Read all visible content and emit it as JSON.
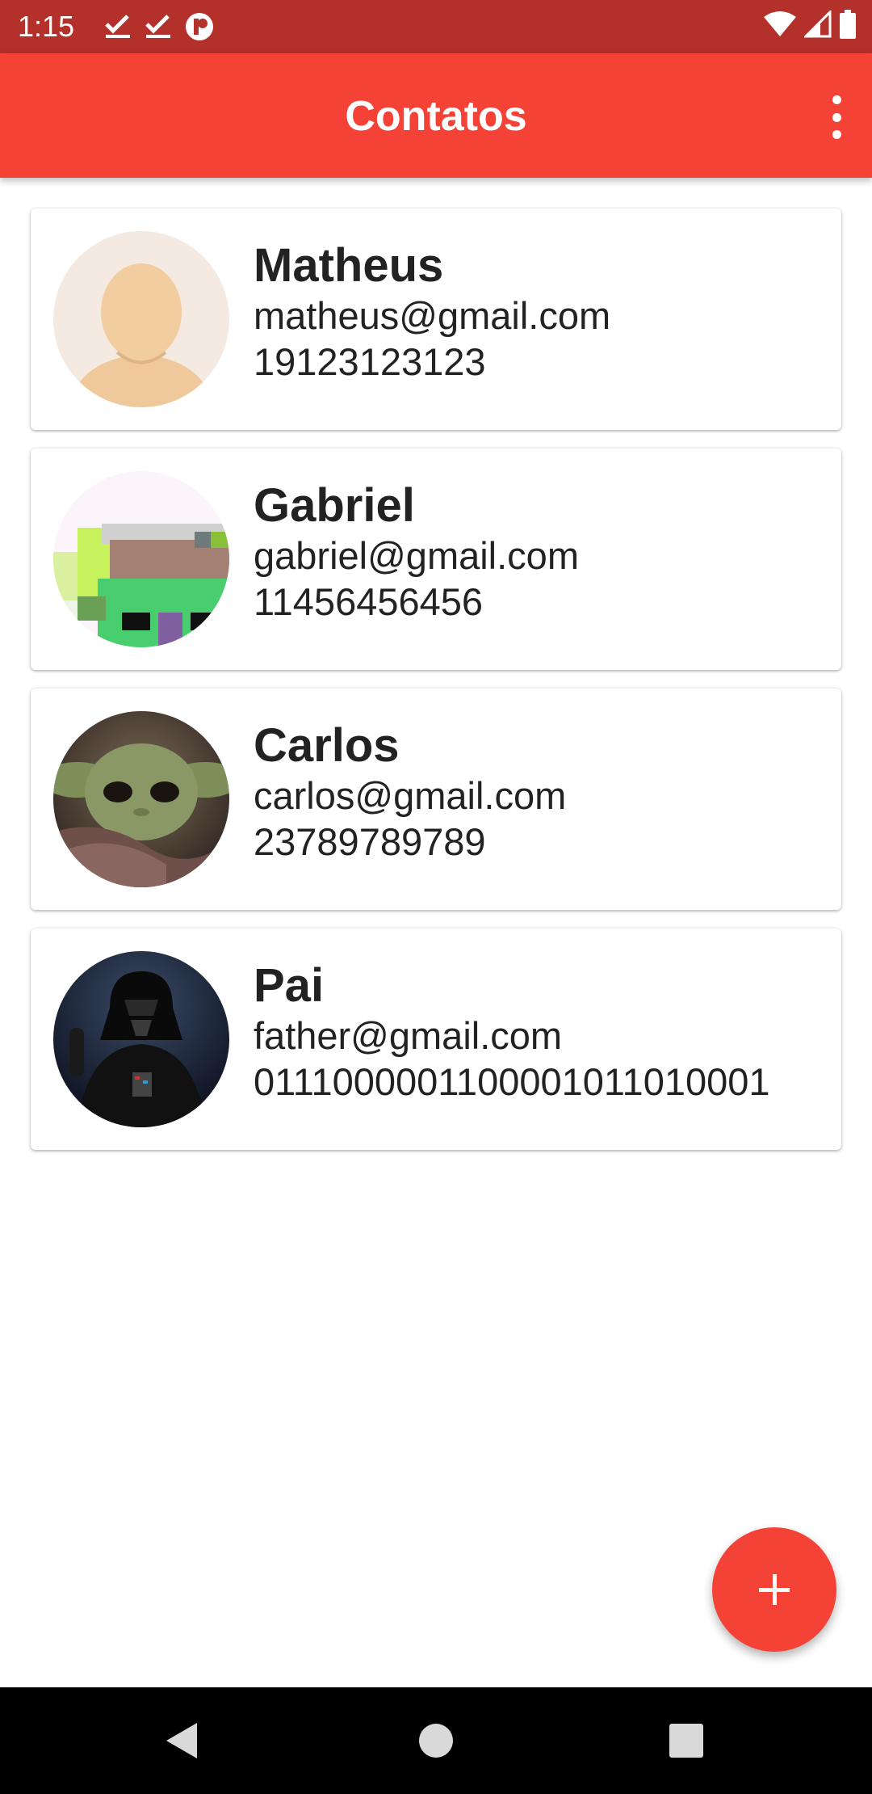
{
  "status_bar": {
    "time": "1:15",
    "icons_left": [
      "check-download-icon",
      "check-download-icon",
      "recorder-icon"
    ],
    "icons_right": [
      "wifi-icon",
      "signal-icon",
      "battery-icon"
    ]
  },
  "app_bar": {
    "title": "Contatos",
    "menu_icon": "more-vert-icon"
  },
  "contacts": [
    {
      "name": "Matheus",
      "email": "matheus@gmail.com",
      "phone": "19123123123",
      "avatar": "default-person-avatar"
    },
    {
      "name": "Gabriel",
      "email": "gabriel@gmail.com",
      "phone": "11456456456",
      "avatar": "pixel-art-avatar"
    },
    {
      "name": "Carlos",
      "email": "carlos@gmail.com",
      "phone": "23789789789",
      "avatar": "baby-yoda-photo"
    },
    {
      "name": "Pai",
      "email": "father@gmail.com",
      "phone": "0111000001100001011010001",
      "avatar": "darth-vader-photo"
    }
  ],
  "fab": {
    "icon": "plus-icon"
  },
  "nav_bar": {
    "buttons": [
      "back-icon",
      "home-icon",
      "recents-icon"
    ]
  },
  "colors": {
    "status_bar": "#b3302b",
    "app_bar": "#f44336",
    "fab": "#f44336",
    "nav_bar": "#000000"
  }
}
